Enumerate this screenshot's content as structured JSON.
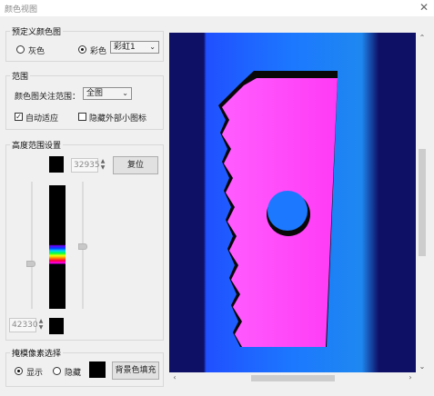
{
  "window": {
    "title": "颜色视图",
    "close_icon": "close-icon"
  },
  "predefined": {
    "group_label": "预定义颜色图",
    "gray_label": "灰色",
    "color_label": "彩色",
    "selected_mode": "彩色",
    "palette_value": "彩虹1"
  },
  "range": {
    "group_label": "范围",
    "focus_label": "颜色图关注范围：",
    "focus_value": "全图",
    "auto_fit_label": "自动适应",
    "auto_fit_checked": true,
    "hide_icon_label": "隐藏外部小图标",
    "hide_icon_checked": false
  },
  "height": {
    "group_label": "高度范围设置",
    "upper_value": "32935",
    "lower_value": "42330",
    "reset_label": "复位"
  },
  "mask": {
    "group_label": "掩模像素选择",
    "show_label": "显示",
    "hide_label": "隐藏",
    "selected": "显示",
    "fill_label": "背景色填充"
  },
  "colors": {
    "magenta": "#ff4fff",
    "blue": "#1c78ff",
    "navy": "#0e1066"
  }
}
